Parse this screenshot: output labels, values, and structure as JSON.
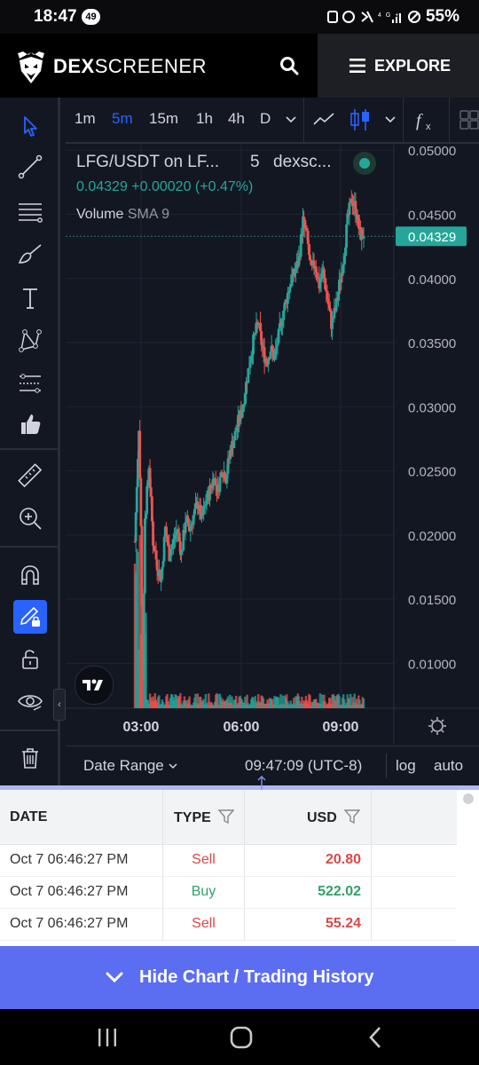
{
  "status": {
    "time": "18:47",
    "notif_count": "49",
    "battery": "55%"
  },
  "header": {
    "brand_bold": "DEX",
    "brand_light": "SCREENER",
    "explore_label": "EXPLORE"
  },
  "toolbar": {
    "timeframes": [
      "1m",
      "5m",
      "15m",
      "1h",
      "4h",
      "D"
    ],
    "active_timeframe": "5m"
  },
  "chart_header": {
    "symbol": "LFG/USDT on LF...",
    "interval": "5",
    "source": "dexsc...",
    "price": "0.04329",
    "change": "+0.00020 (+0.47%)",
    "volume_label": "Volume",
    "sma_label": "SMA 9"
  },
  "chart_data": {
    "type": "candlestick",
    "title": "LFG/USDT on LF...",
    "xlabel": "",
    "ylabel": "",
    "x_ticks": [
      "03:00",
      "06:00",
      "09:00"
    ],
    "y_ticks": [
      "0.05000",
      "0.04500",
      "0.04000",
      "0.03500",
      "0.03000",
      "0.02500",
      "0.02000",
      "0.01500",
      "0.01000"
    ],
    "ylim": [
      0.0065,
      0.0505
    ],
    "last_price": 0.04329,
    "last_price_label": "0.04329",
    "up_color": "#26a69a",
    "down_color": "#ef5350",
    "close_path": [
      [
        0,
        0.0195
      ],
      [
        2,
        0.024
      ],
      [
        4,
        0.0285
      ],
      [
        6,
        0.0205
      ],
      [
        8,
        0.009
      ],
      [
        10,
        0.021
      ],
      [
        14,
        0.0255
      ],
      [
        18,
        0.0195
      ],
      [
        22,
        0.0177
      ],
      [
        26,
        0.0165
      ],
      [
        30,
        0.0205
      ],
      [
        34,
        0.0185
      ],
      [
        38,
        0.0195
      ],
      [
        42,
        0.0205
      ],
      [
        46,
        0.0185
      ],
      [
        50,
        0.0212
      ],
      [
        54,
        0.0205
      ],
      [
        58,
        0.0215
      ],
      [
        62,
        0.0225
      ],
      [
        66,
        0.0212
      ],
      [
        70,
        0.0225
      ],
      [
        74,
        0.0235
      ],
      [
        78,
        0.0245
      ],
      [
        82,
        0.0235
      ],
      [
        86,
        0.0252
      ],
      [
        90,
        0.0245
      ],
      [
        94,
        0.0265
      ],
      [
        98,
        0.0275
      ],
      [
        102,
        0.0288
      ],
      [
        106,
        0.0298
      ],
      [
        110,
        0.0318
      ],
      [
        114,
        0.0338
      ],
      [
        118,
        0.0355
      ],
      [
        122,
        0.0365
      ],
      [
        126,
        0.0345
      ],
      [
        130,
        0.0335
      ],
      [
        134,
        0.0345
      ],
      [
        138,
        0.0338
      ],
      [
        142,
        0.0355
      ],
      [
        146,
        0.0372
      ],
      [
        150,
        0.0385
      ],
      [
        154,
        0.0398
      ],
      [
        158,
        0.0405
      ],
      [
        162,
        0.0415
      ],
      [
        166,
        0.0445
      ],
      [
        170,
        0.0432
      ],
      [
        174,
        0.0405
      ],
      [
        178,
        0.0412
      ],
      [
        182,
        0.0395
      ],
      [
        186,
        0.0405
      ],
      [
        190,
        0.0385
      ],
      [
        194,
        0.0365
      ],
      [
        198,
        0.0375
      ],
      [
        202,
        0.0395
      ],
      [
        206,
        0.0415
      ],
      [
        210,
        0.0445
      ],
      [
        214,
        0.0462
      ],
      [
        218,
        0.0455
      ],
      [
        222,
        0.0435
      ],
      [
        226,
        0.0433
      ]
    ]
  },
  "bottom_bar": {
    "date_range": "Date Range",
    "time": "09:47:09 (UTC-8)",
    "log": "log",
    "auto": "auto"
  },
  "history": {
    "columns": [
      "DATE",
      "TYPE",
      "USD"
    ],
    "rows": [
      {
        "date": "Oct 7 06:46:27 PM",
        "type": "Sell",
        "usd": "20.80"
      },
      {
        "date": "Oct 7 06:46:27 PM",
        "type": "Buy",
        "usd": "522.02"
      },
      {
        "date": "Oct 7 06:46:27 PM",
        "type": "Sell",
        "usd": "55.24"
      }
    ]
  },
  "hide_button": "Hide Chart / Trading History"
}
